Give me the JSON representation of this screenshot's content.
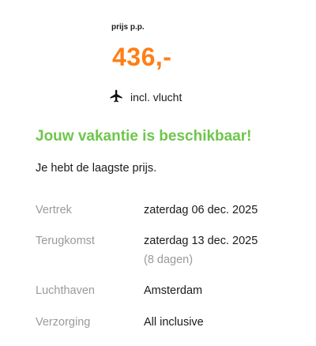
{
  "price": {
    "label": "prijs p.p.",
    "amount": "436,-",
    "accent_color": "#ff7e16"
  },
  "flight": {
    "icon": "airplane-icon",
    "label": "incl. vlucht"
  },
  "availability": {
    "headline": "Jouw vakantie is beschikbaar!",
    "headline_color": "#6ec64b",
    "subline": "Je hebt de laagste prijs."
  },
  "details": {
    "departure": {
      "label": "Vertrek",
      "value": "zaterdag 06 dec. 2025"
    },
    "return": {
      "label": "Terugkomst",
      "value": "zaterdag 13 dec. 2025",
      "note": "(8 dagen)"
    },
    "airport": {
      "label": "Luchthaven",
      "value": "Amsterdam"
    },
    "board": {
      "label": "Verzorging",
      "value": "All inclusive"
    }
  }
}
